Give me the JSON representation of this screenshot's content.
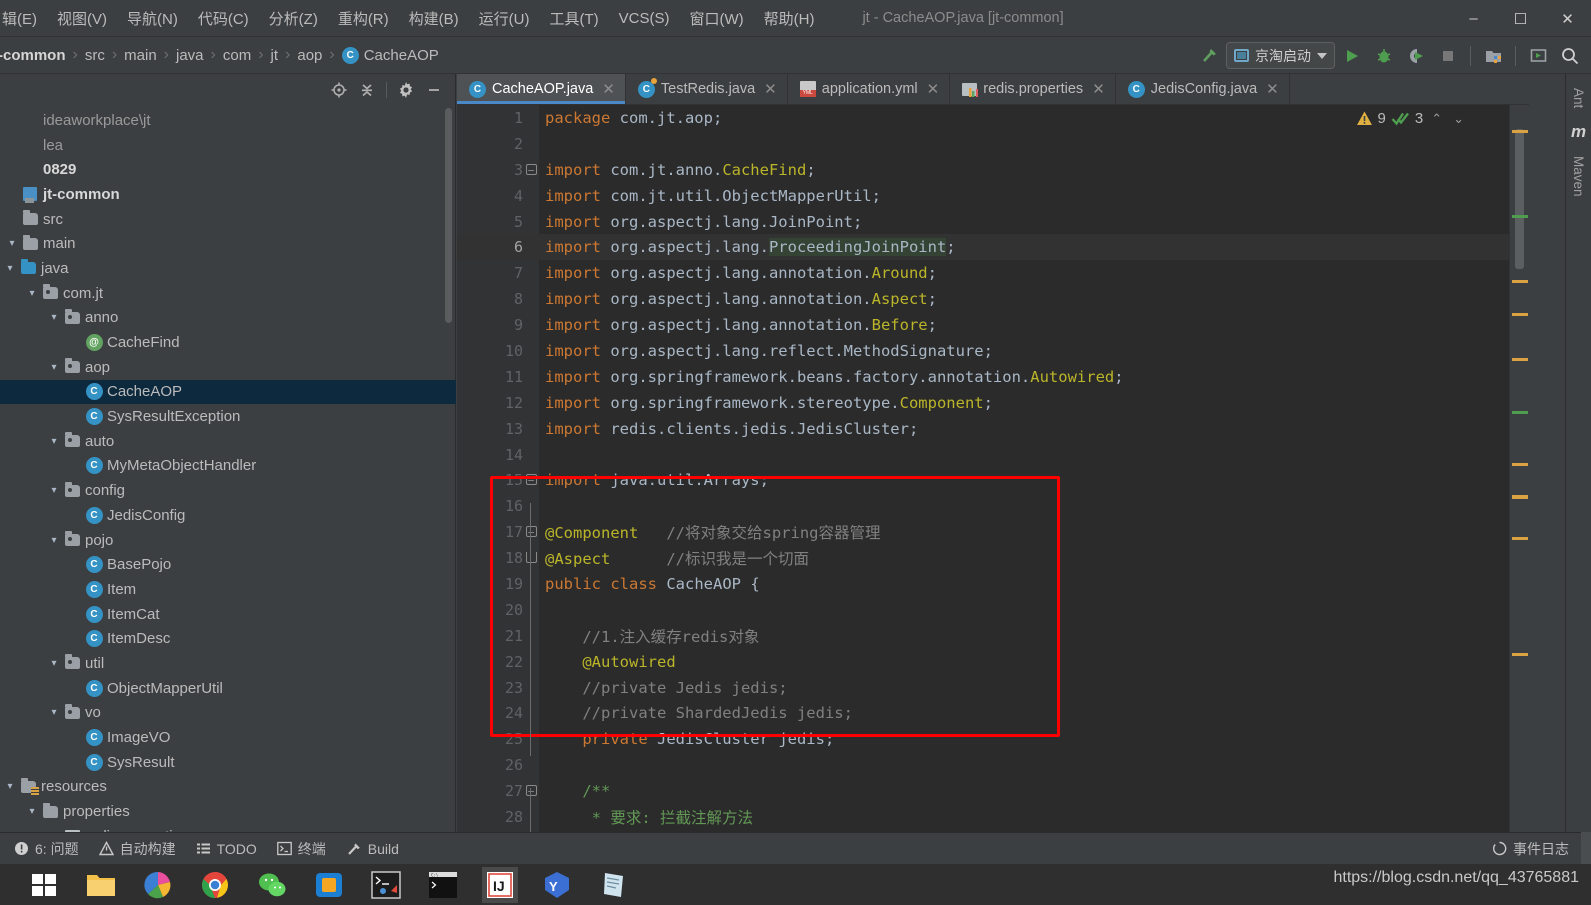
{
  "window": {
    "title": "jt - CacheAOP.java [jt-common]",
    "minimize": "–",
    "maximize": "☐",
    "close": "✕"
  },
  "menu": [
    {
      "label": "辑(E)"
    },
    {
      "label": "视图(V)"
    },
    {
      "label": "导航(N)"
    },
    {
      "label": "代码(C)"
    },
    {
      "label": "分析(Z)"
    },
    {
      "label": "重构(R)"
    },
    {
      "label": "构建(B)"
    },
    {
      "label": "运行(U)"
    },
    {
      "label": "工具(T)"
    },
    {
      "label": "VCS(S)"
    },
    {
      "label": "窗口(W)"
    },
    {
      "label": "帮助(H)"
    }
  ],
  "breadcrumb": [
    {
      "label": "t-common",
      "icon": ""
    },
    {
      "label": "src",
      "icon": ""
    },
    {
      "label": "main",
      "icon": ""
    },
    {
      "label": "java",
      "icon": ""
    },
    {
      "label": "com",
      "icon": ""
    },
    {
      "label": "jt",
      "icon": ""
    },
    {
      "label": "aop",
      "icon": ""
    },
    {
      "label": "CacheAOP",
      "icon": "class-icon",
      "badge": "C"
    }
  ],
  "toolbar": {
    "build_icon": "hammer-icon",
    "run_config": "京淘启动",
    "run_icon": "run-icon",
    "debug_icon": "debug-icon",
    "coverage_icon": "run-with-coverage-icon",
    "stop_icon": "stop-icon",
    "project_structure_icon": "project-structure-icon",
    "updates_icon": "update-icon",
    "search_icon": "search-everywhere-icon"
  },
  "project_panel": {
    "tools": [
      "locate-icon",
      "collapse-all-icon",
      "settings-icon",
      "hide-icon"
    ],
    "tree": [
      {
        "depth": 0,
        "label": "ideaworkplace\\jt",
        "icon": "none",
        "style": "muted",
        "arrow": ""
      },
      {
        "depth": 0,
        "label": "lea",
        "icon": "none",
        "style": "muted",
        "arrow": ""
      },
      {
        "depth": 0,
        "label": "0829",
        "icon": "none",
        "style": "bold",
        "arrow": ""
      },
      {
        "depth": 0,
        "label": "jt-common",
        "icon": "module",
        "style": "bold",
        "arrow": ""
      },
      {
        "depth": 1,
        "label": "src",
        "icon": "folder",
        "style": "",
        "arrow": ""
      },
      {
        "depth": 1,
        "label": "main",
        "icon": "folder",
        "style": "",
        "arrow": "v"
      },
      {
        "depth": 2,
        "label": "java",
        "icon": "folder-blue",
        "style": "",
        "arrow": "v"
      },
      {
        "depth": 3,
        "label": "com.jt",
        "icon": "package",
        "style": "",
        "arrow": "v"
      },
      {
        "depth": 4,
        "label": "anno",
        "icon": "package",
        "style": "",
        "arrow": "v"
      },
      {
        "depth": 5,
        "label": "CacheFind",
        "icon": "annotation",
        "style": "",
        "arrow": ""
      },
      {
        "depth": 4,
        "label": "aop",
        "icon": "package",
        "style": "",
        "arrow": "v"
      },
      {
        "depth": 5,
        "label": "CacheAOP",
        "icon": "class",
        "style": "selected",
        "arrow": ""
      },
      {
        "depth": 5,
        "label": "SysResultException",
        "icon": "class",
        "style": "",
        "arrow": ""
      },
      {
        "depth": 4,
        "label": "auto",
        "icon": "package",
        "style": "",
        "arrow": "v"
      },
      {
        "depth": 5,
        "label": "MyMetaObjectHandler",
        "icon": "class",
        "style": "",
        "arrow": ""
      },
      {
        "depth": 4,
        "label": "config",
        "icon": "package",
        "style": "",
        "arrow": "v"
      },
      {
        "depth": 5,
        "label": "JedisConfig",
        "icon": "class",
        "style": "",
        "arrow": ""
      },
      {
        "depth": 4,
        "label": "pojo",
        "icon": "package",
        "style": "",
        "arrow": "v"
      },
      {
        "depth": 5,
        "label": "BasePojo",
        "icon": "class",
        "style": "",
        "arrow": ""
      },
      {
        "depth": 5,
        "label": "Item",
        "icon": "class",
        "style": "",
        "arrow": ""
      },
      {
        "depth": 5,
        "label": "ItemCat",
        "icon": "class",
        "style": "",
        "arrow": ""
      },
      {
        "depth": 5,
        "label": "ItemDesc",
        "icon": "class",
        "style": "",
        "arrow": ""
      },
      {
        "depth": 4,
        "label": "util",
        "icon": "package",
        "style": "",
        "arrow": "v"
      },
      {
        "depth": 5,
        "label": "ObjectMapperUtil",
        "icon": "class",
        "style": "",
        "arrow": ""
      },
      {
        "depth": 4,
        "label": "vo",
        "icon": "package",
        "style": "",
        "arrow": "v"
      },
      {
        "depth": 5,
        "label": "ImageVO",
        "icon": "class",
        "style": "",
        "arrow": ""
      },
      {
        "depth": 5,
        "label": "SysResult",
        "icon": "class",
        "style": "",
        "arrow": ""
      },
      {
        "depth": 2,
        "label": "resources",
        "icon": "folder-res",
        "style": "",
        "arrow": "v"
      },
      {
        "depth": 3,
        "label": "properties",
        "icon": "folder",
        "style": "",
        "arrow": "v"
      },
      {
        "depth": 4,
        "label": "redis.properties",
        "icon": "properties",
        "style": "",
        "arrow": ""
      }
    ]
  },
  "editor_tabs": [
    {
      "label": "CacheAOP.java",
      "icon": "java-class-icon",
      "active": true
    },
    {
      "label": "TestRedis.java",
      "icon": "java-test-class-icon",
      "active": false
    },
    {
      "label": "application.yml",
      "icon": "yaml-icon",
      "active": false
    },
    {
      "label": "redis.properties",
      "icon": "properties-icon",
      "active": false
    },
    {
      "label": "JedisConfig.java",
      "icon": "java-class-icon",
      "active": false
    }
  ],
  "inspections": {
    "warning_count": "9",
    "ok_count": "3",
    "prev": "⌃",
    "next": "⌄"
  },
  "right_strip": [
    {
      "label": "Ant"
    },
    {
      "label": "m"
    },
    {
      "label": "Maven"
    }
  ],
  "code": {
    "lines": [
      {
        "n": "1",
        "tokens": [
          {
            "t": "package ",
            "c": "k"
          },
          {
            "t": "com.jt.aop;",
            "c": "pl"
          }
        ]
      },
      {
        "n": "2",
        "tokens": []
      },
      {
        "n": "3",
        "fold": "minus",
        "tokens": [
          {
            "t": "import ",
            "c": "k"
          },
          {
            "t": "com.jt.anno.",
            "c": "pl"
          },
          {
            "t": "CacheFind",
            "c": "an"
          },
          {
            "t": ";",
            "c": "pl"
          }
        ]
      },
      {
        "n": "4",
        "tokens": [
          {
            "t": "import ",
            "c": "k"
          },
          {
            "t": "com.jt.util.ObjectMapperUtil;",
            "c": "pl"
          }
        ]
      },
      {
        "n": "5",
        "tokens": [
          {
            "t": "import ",
            "c": "k"
          },
          {
            "t": "org.aspectj.lang.JoinPoint;",
            "c": "pl"
          }
        ]
      },
      {
        "n": "6",
        "hl": true,
        "tokens": [
          {
            "t": "import ",
            "c": "k"
          },
          {
            "t": "org.aspectj.lang.",
            "c": "pl"
          },
          {
            "t": "ProceedingJoinPoint",
            "c": "pl sel"
          },
          {
            "t": ";",
            "c": "pl"
          }
        ]
      },
      {
        "n": "7",
        "tokens": [
          {
            "t": "import ",
            "c": "k"
          },
          {
            "t": "org.aspectj.lang.annotation.",
            "c": "pl"
          },
          {
            "t": "Around",
            "c": "an"
          },
          {
            "t": ";",
            "c": "pl"
          }
        ]
      },
      {
        "n": "8",
        "tokens": [
          {
            "t": "import ",
            "c": "k"
          },
          {
            "t": "org.aspectj.lang.annotation.",
            "c": "pl"
          },
          {
            "t": "Aspect",
            "c": "an"
          },
          {
            "t": ";",
            "c": "pl"
          }
        ]
      },
      {
        "n": "9",
        "tokens": [
          {
            "t": "import ",
            "c": "k"
          },
          {
            "t": "org.aspectj.lang.annotation.",
            "c": "pl"
          },
          {
            "t": "Before",
            "c": "an"
          },
          {
            "t": ";",
            "c": "pl"
          }
        ]
      },
      {
        "n": "10",
        "tokens": [
          {
            "t": "import ",
            "c": "k"
          },
          {
            "t": "org.aspectj.lang.reflect.MethodSignature;",
            "c": "pl"
          }
        ]
      },
      {
        "n": "11",
        "tokens": [
          {
            "t": "import ",
            "c": "k"
          },
          {
            "t": "org.springframework.beans.factory.annotation.",
            "c": "pl"
          },
          {
            "t": "Autowired",
            "c": "an"
          },
          {
            "t": ";",
            "c": "pl"
          }
        ]
      },
      {
        "n": "12",
        "tokens": [
          {
            "t": "import ",
            "c": "k"
          },
          {
            "t": "org.springframework.stereotype.",
            "c": "pl"
          },
          {
            "t": "Component",
            "c": "an"
          },
          {
            "t": ";",
            "c": "pl"
          }
        ]
      },
      {
        "n": "13",
        "tokens": [
          {
            "t": "import ",
            "c": "k"
          },
          {
            "t": "redis.clients.jedis.JedisCluster;",
            "c": "pl"
          }
        ]
      },
      {
        "n": "14",
        "tokens": []
      },
      {
        "n": "15",
        "fold": "minus",
        "tokens": [
          {
            "t": "import ",
            "c": "k"
          },
          {
            "t": "java.util.Arrays;",
            "c": "pl"
          }
        ]
      },
      {
        "n": "16",
        "tokens": []
      },
      {
        "n": "17",
        "fold": "minus",
        "tokens": [
          {
            "t": "@Component",
            "c": "an"
          },
          {
            "t": "   ",
            "c": "pl"
          },
          {
            "t": "//将对象交给spring容器管理",
            "c": "cm"
          }
        ]
      },
      {
        "n": "18",
        "fold": "end",
        "tokens": [
          {
            "t": "@Aspect",
            "c": "an"
          },
          {
            "t": "      ",
            "c": "pl"
          },
          {
            "t": "//标识我是一个切面",
            "c": "cm"
          }
        ]
      },
      {
        "n": "19",
        "tokens": [
          {
            "t": "public ",
            "c": "k"
          },
          {
            "t": "class ",
            "c": "k"
          },
          {
            "t": "CacheAOP ",
            "c": "pl"
          },
          {
            "t": "{",
            "c": "pl"
          }
        ]
      },
      {
        "n": "20",
        "tokens": []
      },
      {
        "n": "21",
        "tokens": [
          {
            "t": "    //1.注入缓存redis对象",
            "c": "cm"
          }
        ]
      },
      {
        "n": "22",
        "tokens": [
          {
            "t": "    ",
            "c": "pl"
          },
          {
            "t": "@Autowired",
            "c": "an"
          }
        ]
      },
      {
        "n": "23",
        "tokens": [
          {
            "t": "    //private Jedis jedis;",
            "c": "cm"
          }
        ]
      },
      {
        "n": "24",
        "tokens": [
          {
            "t": "    //private ShardedJedis jedis;",
            "c": "cm"
          }
        ]
      },
      {
        "n": "25",
        "tokens": [
          {
            "t": "    ",
            "c": "pl"
          },
          {
            "t": "private ",
            "c": "k"
          },
          {
            "t": "JedisCluster ",
            "c": "pl"
          },
          {
            "t": "jedis;",
            "c": "pl"
          }
        ]
      },
      {
        "n": "26",
        "tokens": []
      },
      {
        "n": "27",
        "fold": "minus",
        "tokens": [
          {
            "t": "    /**",
            "c": "jd"
          }
        ]
      },
      {
        "n": "28",
        "tokens": [
          {
            "t": "     * 要求: 拦截注解方法",
            "c": "jd"
          }
        ]
      }
    ]
  },
  "statusbar": {
    "left": [
      {
        "label": "6: 问题",
        "icon": "problems-icon"
      },
      {
        "label": "自动构建",
        "icon": "build-warning-icon"
      },
      {
        "label": "TODO",
        "icon": "todo-icon"
      },
      {
        "label": "终端",
        "icon": "terminal-icon"
      },
      {
        "label": "Build",
        "icon": "hammer-icon"
      }
    ],
    "right": [
      {
        "label": "事件日志",
        "icon": "event-log-icon"
      }
    ]
  },
  "taskbar": [
    {
      "name": "start-button",
      "icon": "windows-logo"
    },
    {
      "name": "file-explorer",
      "icon": "folder"
    },
    {
      "name": "browser-colorful",
      "icon": "colorful-circle"
    },
    {
      "name": "chrome",
      "icon": "chrome-logo"
    },
    {
      "name": "wechat",
      "icon": "wechat-logo"
    },
    {
      "name": "app-blue",
      "icon": "blue-square"
    },
    {
      "name": "terminal-1",
      "icon": "console"
    },
    {
      "name": "terminal-2",
      "icon": "console-dark"
    },
    {
      "name": "intellij-idea",
      "icon": "idea-logo",
      "active": true
    },
    {
      "name": "app-yy",
      "icon": "yy-logo"
    },
    {
      "name": "app-notes",
      "icon": "notes"
    }
  ],
  "watermark": "https://blog.csdn.net/qq_43765881",
  "colors": {
    "accent": "#4a88c7",
    "keyword": "#cc7832",
    "annotation": "#bbb529",
    "comment": "#808080",
    "javadoc": "#629755",
    "plain": "#a9b7c6",
    "highlight_box": "#ff0000",
    "editor_bg": "#2b2b2b",
    "panel_bg": "#3c3f41"
  }
}
